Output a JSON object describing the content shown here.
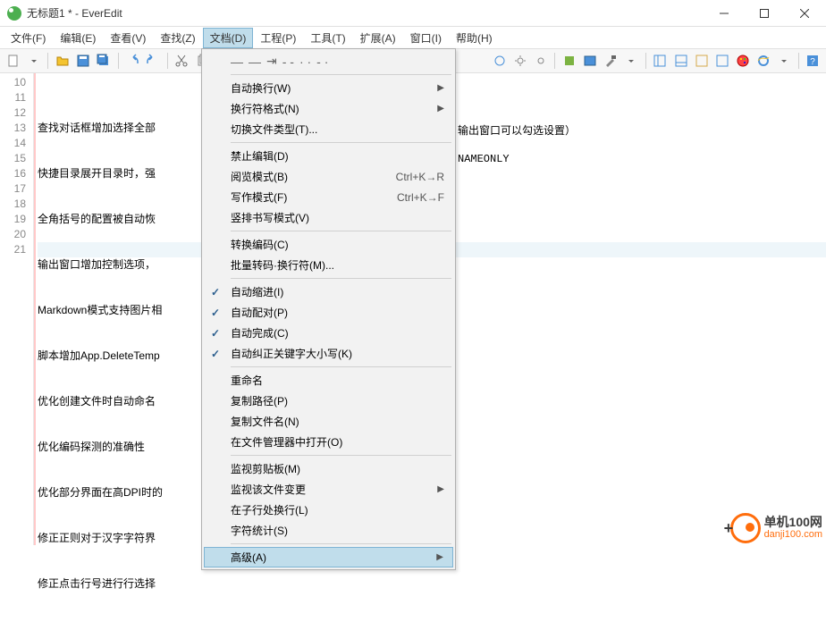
{
  "window": {
    "title": "无标题1 * - EverEdit"
  },
  "menus": {
    "file": "文件(F)",
    "edit": "编辑(E)",
    "view": "查看(V)",
    "search": "查找(Z)",
    "document": "文档(D)",
    "project": "工程(P)",
    "tools": "工具(T)",
    "extensions": "扩展(A)",
    "window": "窗口(I)",
    "help": "帮助(H)"
  },
  "code_lines": [
    "查找对话框增加选择全部",
    "快捷目录展开目录时，强",
    "全角括号的配置被自动恢",
    "输出窗口增加控制选项，",
    "Markdown模式支持图片相",
    "脚本增加App.DeleteTemp",
    "优化创建文件时自动命名",
    "优化编码探测的准确性",
    "优化部分界面在高DPI时的",
    "修正正则对于汉字字符界",
    "修正点击行号进行行选择"
  ],
  "line_numbers": [
    "10",
    "11",
    "12",
    "13",
    "14",
    "15",
    "16",
    "17",
    "18",
    "19",
    "20",
    "21"
  ],
  "bg_fragments": {
    "a": "输出窗口可以勾选设置）",
    "b": "NAMEONLY"
  },
  "dropdown": {
    "auto_wrap": "自动换行(W)",
    "wrap_format": "换行符格式(N)",
    "switch_type": "切换文件类型(T)...",
    "no_edit": "禁止编辑(D)",
    "read_mode": "阅览模式(B)",
    "read_sc": "Ctrl+K→R",
    "write_mode": "写作模式(F)",
    "write_sc": "Ctrl+K→F",
    "vertical": "竖排书写模式(V)",
    "convert_enc": "转换编码(C)",
    "batch": "批量转码·换行符(M)...",
    "auto_indent": "自动缩进(I)",
    "auto_pair": "自动配对(P)",
    "auto_complete": "自动完成(C)",
    "auto_case": "自动纠正关键字大小写(K)",
    "rename": "重命名",
    "copy_path": "复制路径(P)",
    "copy_name": "复制文件名(N)",
    "open_in_fm": "在文件管理器中打开(O)",
    "watch_clip": "监视剪贴板(M)",
    "watch_file": "监视该文件变更",
    "sub_exec": "在子行处换行(L)",
    "char_stats": "字符统计(S)",
    "advanced": "高级(A)"
  },
  "watermark": {
    "t1": "单机100网",
    "t2": "danji100.com"
  }
}
